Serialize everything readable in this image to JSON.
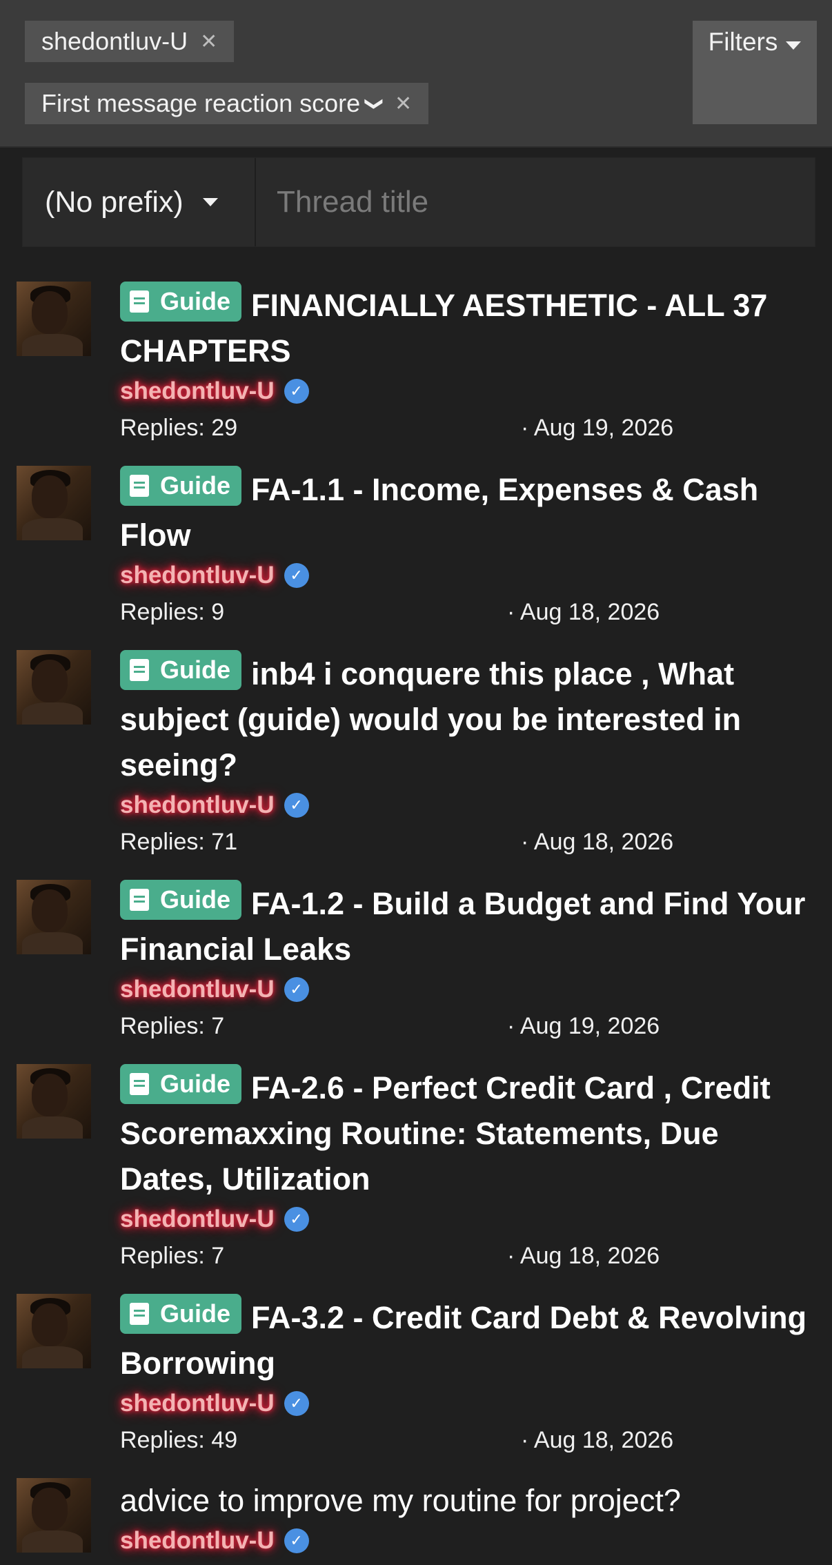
{
  "filters_bar": {
    "chip_user": {
      "label": "shedontluv-U",
      "remove": "✕"
    },
    "chip_sort": {
      "label": "First message reaction score",
      "chevron": "❯",
      "remove": "✕"
    },
    "filters_button": "Filters"
  },
  "new_thread": {
    "prefix_label": "(No prefix)",
    "title_placeholder": "Thread title"
  },
  "threads": [
    {
      "prefix": "Guide",
      "title": "FINANCIALLY AESTHETIC - ALL 37 CHAPTERS",
      "author": "shedontluv-U",
      "replies": "Replies: 29",
      "date": "· Aug 19, 2026"
    },
    {
      "prefix": "Guide",
      "title": "FA-1.1 - Income, Expenses & Cash Flow",
      "author": "shedontluv-U",
      "replies": "Replies: 9",
      "date": "· Aug 18, 2026"
    },
    {
      "prefix": "Guide",
      "title": "inb4 i conquere this place , What subject (guide) would you be interested in seeing?",
      "author": "shedontluv-U",
      "replies": "Replies: 71",
      "date": "· Aug 18, 2026"
    },
    {
      "prefix": "Guide",
      "title": "FA-1.2 - Build a Budget and Find Your Financial Leaks",
      "author": "shedontluv-U",
      "replies": "Replies: 7",
      "date": "· Aug 19, 2026"
    },
    {
      "prefix": "Guide",
      "title": "FA-2.6 - Perfect Credit Card , Credit Scoremaxxing Routine: Statements, Due Dates, Utilization",
      "author": "shedontluv-U",
      "replies": "Replies: 7",
      "date": "· Aug 18, 2026"
    },
    {
      "prefix": "Guide",
      "title": "FA-3.2 - Credit Card Debt & Revolving Borrowing",
      "author": "shedontluv-U",
      "replies": "Replies: 49",
      "date": "· Aug 18, 2026"
    },
    {
      "prefix": "",
      "title": "advice to improve my routine for project?",
      "author": "shedontluv-U",
      "replies": "",
      "date": ""
    }
  ],
  "colors": {
    "background": "#1f1f1f",
    "guide_badge": "#4aad8c",
    "username_glow": "#e0223c",
    "verified": "#4a90e2"
  },
  "icons": {
    "remove": "close-icon",
    "dropdown": "caret-down-icon",
    "guide": "book-icon",
    "verified": "verified-check-icon"
  }
}
